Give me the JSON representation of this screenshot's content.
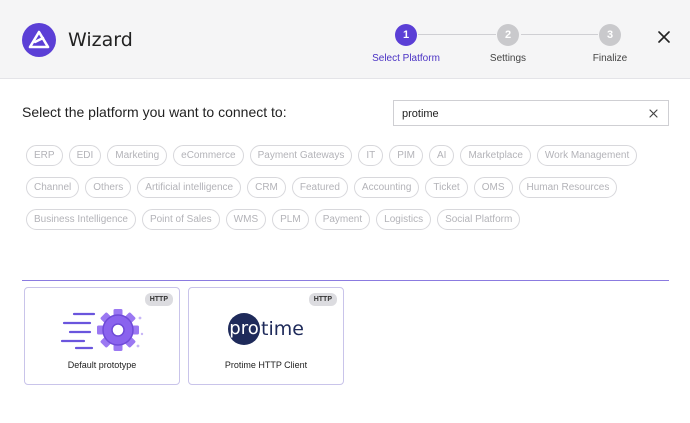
{
  "app": {
    "title": "Wizard"
  },
  "steps": [
    {
      "number": "1",
      "label": "Select Platform",
      "active": true
    },
    {
      "number": "2",
      "label": "Settings",
      "active": false
    },
    {
      "number": "3",
      "label": "Finalize",
      "active": false
    }
  ],
  "prompt": "Select the platform you want to connect to:",
  "search": {
    "value": "protime",
    "placeholder": ""
  },
  "categories": [
    "ERP",
    "EDI",
    "Marketing",
    "eCommerce",
    "Payment Gateways",
    "IT",
    "PIM",
    "AI",
    "Marketplace",
    "Work Management",
    "Channel",
    "Others",
    "Artificial intelligence",
    "CRM",
    "Featured",
    "Accounting",
    "Ticket",
    "OMS",
    "Human Resources",
    "Business Intelligence",
    "Point of Sales",
    "WMS",
    "PLM",
    "Payment",
    "Logistics",
    "Social Platform"
  ],
  "results": [
    {
      "label": "Default prototype",
      "badge": "HTTP",
      "icon": "gear-speed-icon"
    },
    {
      "label": "Protime HTTP Client",
      "badge": "HTTP",
      "icon": "protime-logo",
      "logo_pro": "pro",
      "logo_rest": "time"
    }
  ],
  "colors": {
    "accent": "#5b3fd6",
    "divider": "#8b7be0",
    "chip_text": "#b3b3b8"
  }
}
